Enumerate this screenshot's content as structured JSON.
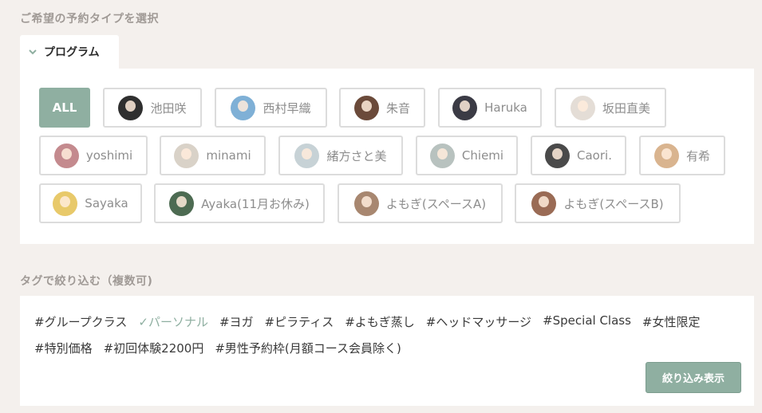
{
  "section1": {
    "title": "ご希望の予約タイプを選択"
  },
  "tab": {
    "label": "プログラム",
    "icon": "chevron-down-icon"
  },
  "instructors": [
    {
      "label": "ALL",
      "active": true
    },
    {
      "label": "池田咲",
      "avatar_color": "#2f2f2f"
    },
    {
      "label": "西村早織",
      "avatar_color": "#7fb0d6"
    },
    {
      "label": "朱音",
      "avatar_color": "#6b4a3a"
    },
    {
      "label": "Haruka",
      "avatar_color": "#3b3b45"
    },
    {
      "label": "坂田直美",
      "avatar_color": "#e4ddd6"
    },
    {
      "label": "yoshimi",
      "avatar_color": "#c48a8e"
    },
    {
      "label": "minami",
      "avatar_color": "#d9d2c8"
    },
    {
      "label": "緒方さと美",
      "avatar_color": "#c7d2d6"
    },
    {
      "label": "Chiemi",
      "avatar_color": "#b8c2bf"
    },
    {
      "label": "Caori.",
      "avatar_color": "#4a4a4a"
    },
    {
      "label": "有希",
      "avatar_color": "#d9b48f"
    },
    {
      "label": "Sayaka",
      "avatar_color": "#e8c96a"
    },
    {
      "label": "Ayaka(11月お休み)",
      "avatar_color": "#4d6b52"
    },
    {
      "label": "よもぎ(スペースA)",
      "avatar_color": "#a88770"
    },
    {
      "label": "よもぎ(スペースB)",
      "avatar_color": "#9a6b55"
    }
  ],
  "section2": {
    "title": "タグで絞り込む（複数可)"
  },
  "tags_row1": [
    {
      "label": "#グループクラス"
    },
    {
      "label": "✓パーソナル",
      "checked": true
    },
    {
      "label": "#ヨガ"
    },
    {
      "label": "#ピラティス"
    },
    {
      "label": "#よもぎ蒸し"
    },
    {
      "label": "#ヘッドマッサージ"
    },
    {
      "label": "#Special Class"
    },
    {
      "label": "#女性限定"
    }
  ],
  "tags_row2": [
    {
      "label": "#特別価格"
    },
    {
      "label": "#初回体験2200円"
    },
    {
      "label": "#男性予約枠(月額コース会員除く)"
    }
  ],
  "filter_button": {
    "label": "絞り込み表示"
  },
  "colors": {
    "accent": "#8fafa1",
    "background": "#f4f0ed"
  }
}
